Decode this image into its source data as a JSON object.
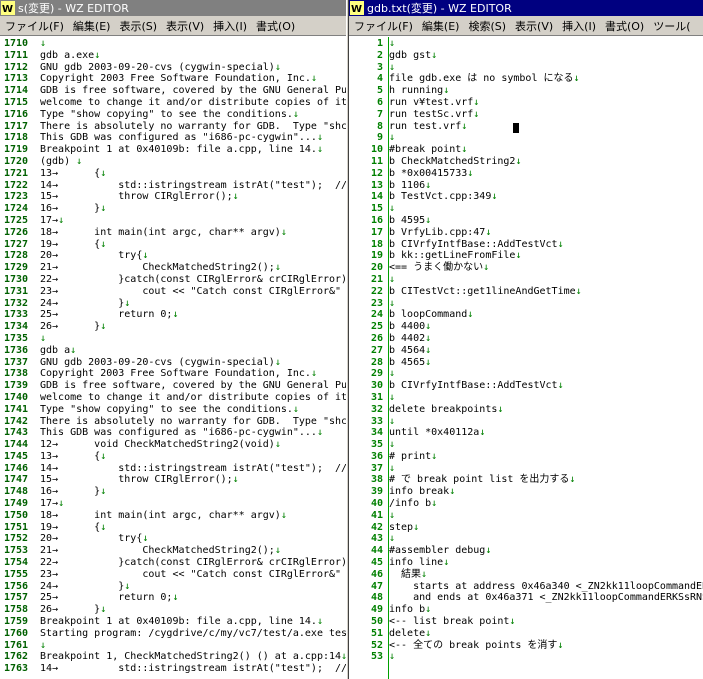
{
  "left_window": {
    "title": "s(変更) - WZ EDITOR",
    "menus": [
      "ファイル(F)",
      "編集(E)",
      "表示(S)",
      "表示(V)",
      "挿入(I)",
      "書式(O)"
    ],
    "lines": [
      {
        "n": "1710",
        "t": ""
      },
      {
        "n": "1711",
        "t": "gdb a.exe"
      },
      {
        "n": "1712",
        "t": "GNU gdb 2003-09-20-cvs (cygwin-special)"
      },
      {
        "n": "1713",
        "t": "Copyright 2003 Free Software Foundation, Inc."
      },
      {
        "n": "1714",
        "t": "GDB is free software, covered by the GNU General Pu"
      },
      {
        "n": "1715",
        "t": "welcome to change it and/or distribute copies of it"
      },
      {
        "n": "1716",
        "t": "Type \"show copying\" to see the conditions."
      },
      {
        "n": "1717",
        "t": "There is absolutely no warranty for GDB.  Type \"shc"
      },
      {
        "n": "1718",
        "t": "This GDB was configured as \"i686-pc-cygwin\"..."
      },
      {
        "n": "1719",
        "t": "Breakpoint 1 at 0x40109b: file a.cpp, line 14."
      },
      {
        "n": "1720",
        "t": "(gdb) "
      },
      {
        "n": "1721",
        "t": "13→      {"
      },
      {
        "n": "1722",
        "t": "14→          std::istringstream istrAt(\"test\");  //"
      },
      {
        "n": "1723",
        "t": "15→          throw CIRglError();"
      },
      {
        "n": "1724",
        "t": "16→      }"
      },
      {
        "n": "1725",
        "t": "17→"
      },
      {
        "n": "1726",
        "t": "18→      int main(int argc, char** argv)"
      },
      {
        "n": "1727",
        "t": "19→      {"
      },
      {
        "n": "1728",
        "t": "20→          try{"
      },
      {
        "n": "1729",
        "t": "21→              CheckMatchedString2();"
      },
      {
        "n": "1730",
        "t": "22→          }catch(const CIRglError& crCIRglError){"
      },
      {
        "n": "1731",
        "t": "23→              cout << \"Catch const CIRglError&\" <"
      },
      {
        "n": "1732",
        "t": "24→          }"
      },
      {
        "n": "1733",
        "t": "25→          return 0;"
      },
      {
        "n": "1734",
        "t": "26→      }"
      },
      {
        "n": "1735",
        "t": ""
      },
      {
        "n": "1736",
        "t": "gdb a"
      },
      {
        "n": "1737",
        "t": "GNU gdb 2003-09-20-cvs (cygwin-special)"
      },
      {
        "n": "1738",
        "t": "Copyright 2003 Free Software Foundation, Inc."
      },
      {
        "n": "1739",
        "t": "GDB is free software, covered by the GNU General Pu"
      },
      {
        "n": "1740",
        "t": "welcome to change it and/or distribute copies of it"
      },
      {
        "n": "1741",
        "t": "Type \"show copying\" to see the conditions."
      },
      {
        "n": "1742",
        "t": "There is absolutely no warranty for GDB.  Type \"shc"
      },
      {
        "n": "1743",
        "t": "This GDB was configured as \"i686-pc-cygwin\"..."
      },
      {
        "n": "1744",
        "t": "12→      void CheckMatchedString2(void)"
      },
      {
        "n": "1745",
        "t": "13→      {"
      },
      {
        "n": "1746",
        "t": "14→          std::istringstream istrAt(\"test\");  //"
      },
      {
        "n": "1747",
        "t": "15→          throw CIRglError();"
      },
      {
        "n": "1748",
        "t": "16→      }"
      },
      {
        "n": "1749",
        "t": "17→"
      },
      {
        "n": "1750",
        "t": "18→      int main(int argc, char** argv)"
      },
      {
        "n": "1751",
        "t": "19→      {"
      },
      {
        "n": "1752",
        "t": "20→          try{"
      },
      {
        "n": "1753",
        "t": "21→              CheckMatchedString2();"
      },
      {
        "n": "1754",
        "t": "22→          }catch(const CIRglError& crCIRglError){"
      },
      {
        "n": "1755",
        "t": "23→              cout << \"Catch const CIRglError&\" <"
      },
      {
        "n": "1756",
        "t": "24→          }"
      },
      {
        "n": "1757",
        "t": "25→          return 0;"
      },
      {
        "n": "1758",
        "t": "26→      }"
      },
      {
        "n": "1759",
        "t": "Breakpoint 1 at 0x40109b: file a.cpp, line 14."
      },
      {
        "n": "1760",
        "t": "Starting program: /cygdrive/c/my/vc7/test/a.exe tes"
      },
      {
        "n": "1761",
        "t": ""
      },
      {
        "n": "1762",
        "t": "Breakpoint 1, CheckMatchedString2() () at a.cpp:14"
      },
      {
        "n": "1763",
        "t": "14→          std::istringstream istrAt(\"test\");  //"
      }
    ]
  },
  "right_window": {
    "title": "gdb.txt(変更) - WZ EDITOR",
    "menus": [
      "ファイル(F)",
      "編集(E)",
      "検索(S)",
      "表示(V)",
      "挿入(I)",
      "書式(O)",
      "ツール("
    ],
    "lines": [
      {
        "n": "1",
        "t": ""
      },
      {
        "n": "2",
        "t": "gdb gst"
      },
      {
        "n": "3",
        "t": ""
      },
      {
        "n": "4",
        "t": "file gdb.exe は no symbol になる"
      },
      {
        "n": "5",
        "t": "h running"
      },
      {
        "n": "6",
        "t": "run v¥test.vrf"
      },
      {
        "n": "7",
        "t": "run testSc.vrf"
      },
      {
        "n": "8",
        "t": "run test.vrf"
      },
      {
        "n": "9",
        "t": ""
      },
      {
        "n": "10",
        "t": "#break point"
      },
      {
        "n": "11",
        "t": "b CheckMatchedString2"
      },
      {
        "n": "12",
        "t": "b *0x00415733"
      },
      {
        "n": "13",
        "t": "b 1106"
      },
      {
        "n": "14",
        "t": "b TestVct.cpp:349"
      },
      {
        "n": "15",
        "t": ""
      },
      {
        "n": "16",
        "t": "b 4595"
      },
      {
        "n": "17",
        "t": "b VrfyLib.cpp:47"
      },
      {
        "n": "18",
        "t": "b CIVrfyIntfBase::AddTestVct"
      },
      {
        "n": "19",
        "t": "b kk::getLineFromFile"
      },
      {
        "n": "20",
        "t": "<== うまく働かない"
      },
      {
        "n": "21",
        "t": ""
      },
      {
        "n": "22",
        "t": "b CITestVct::get1lineAndGetTime"
      },
      {
        "n": "23",
        "t": ""
      },
      {
        "n": "24",
        "t": "b loopCommand"
      },
      {
        "n": "25",
        "t": "b 4400"
      },
      {
        "n": "26",
        "t": "b 4402"
      },
      {
        "n": "27",
        "t": "b 4564"
      },
      {
        "n": "28",
        "t": "b 4565"
      },
      {
        "n": "29",
        "t": ""
      },
      {
        "n": "30",
        "t": "b CIVrfyIntfBase::AddTestVct"
      },
      {
        "n": "31",
        "t": ""
      },
      {
        "n": "32",
        "t": "delete breakpoints"
      },
      {
        "n": "33",
        "t": ""
      },
      {
        "n": "34",
        "t": "until *0x40112a"
      },
      {
        "n": "35",
        "t": ""
      },
      {
        "n": "36",
        "t": "# print"
      },
      {
        "n": "37",
        "t": ""
      },
      {
        "n": "38",
        "t": "# で break point list を出力する"
      },
      {
        "n": "39",
        "t": "info break"
      },
      {
        "n": "40",
        "t": "/info b"
      },
      {
        "n": "41",
        "t": ""
      },
      {
        "n": "42",
        "t": "step"
      },
      {
        "n": "43",
        "t": ""
      },
      {
        "n": "44",
        "t": "#assembler debug"
      },
      {
        "n": "45",
        "t": "info line"
      },
      {
        "n": "46",
        "t": "  結果"
      },
      {
        "n": "47",
        "t": "    starts at address 0x46a340 <_ZN2kk11loopCommandERK"
      },
      {
        "n": "48",
        "t": "    and ends at 0x46a371 <_ZN2kk11loopCommandERKSsRNS_"
      },
      {
        "n": "49",
        "t": "info b"
      },
      {
        "n": "50",
        "t": "<-- list break point"
      },
      {
        "n": "51",
        "t": "delete"
      },
      {
        "n": "52",
        "t": "<-- 全ての break points を消す"
      },
      {
        "n": "53",
        "t": ""
      }
    ]
  },
  "eol_mark": "↓",
  "colors": {
    "line_number": "#008000",
    "title_active": "#000080",
    "title_inactive": "#808080",
    "menu_bg": "#d4d0c8"
  }
}
